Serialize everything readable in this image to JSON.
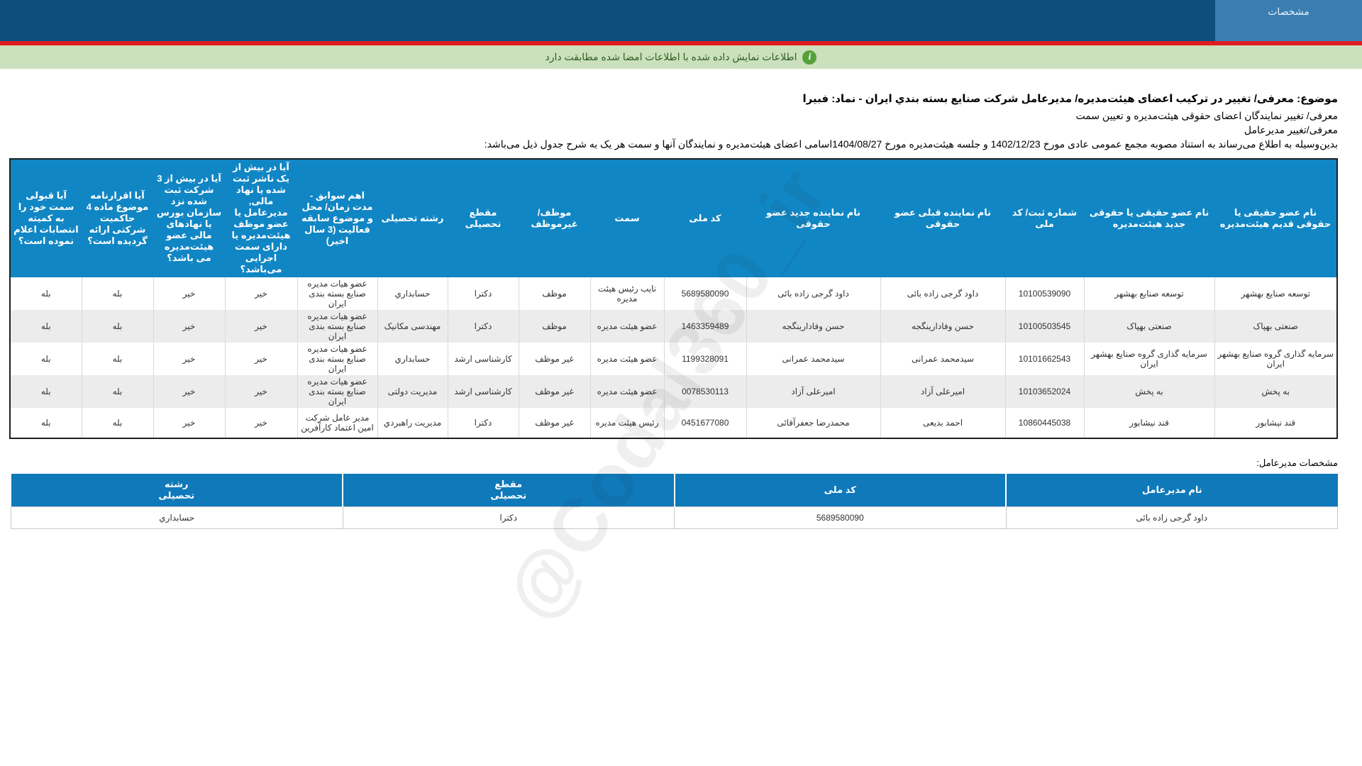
{
  "header": {
    "tab_label": "مشخصات"
  },
  "alert": {
    "text": "اطلاعات نمایش داده شده با اطلاعات امضا شده مطابقت دارد"
  },
  "intro": {
    "subject": "موضوع: معرفی/ تغییر در ترکیب اعضای هیئت‌مدیره/ مدیرعامل شرکت صنایع بسته بندي ایران - نماد: فبیرا",
    "line2": "معرفی/ تغییر نمایندگان اعضای حقوقی هیئت‌مدیره و تعیین سمت",
    "line3": "معرفی/تغییر مدیرعامل",
    "line4": "بدین‌وسیله به اطلاع می‌رساند به استناد مصوبه مجمع عمومی عادی مورخ  1402/12/23  و جلسه هیئت‌مدیره مورخ  1404/08/27اسامی اعضای هیئت‌مدیره و نمایندگان آنها و سمت هر یک به شرح جدول ذیل می‌باشد:"
  },
  "board_table": {
    "headers": [
      "نام عضو حقیقی یا حقوقی قدیم هیئت‌مدیره",
      "نام عضو حقیقی یا حقوقی جدید هیئت‌مدیره",
      "شماره ثبت/ کد ملی",
      "نام نماینده قبلی عضو حقوقی",
      "نام نماینده جدید عضو حقوقی",
      "کد ملی",
      "سمت",
      "موظف/ غیرموظف",
      "مقطع تحصیلی",
      "رشته تحصیلی",
      "اهم سوابق - مدت زمان/ محل و موضوع سابقه فعالیت (3 سال اخیر)",
      "آیا در بیش از یک ناشر ثبت شده یا نهاد مالی, مدیرعامل یا عضو موظف هیئت‌مدیره یا دارای سمت اجرایی می‌باشد؟",
      "آیا در بیش از 3 شرکت ثبت شده نزد سازمان بورس یا نهادهای مالی عضو هیئت‌مدیره می باشد؟",
      "آیا اقرارنامه موضوع ماده 4 حاکمیت شرکتی ارائه گردیده است؟",
      "آیا قبولی سمت خود را به کمیته انتصابات اعلام نموده است؟"
    ],
    "rows": [
      [
        "توسعه صنایع بهشهر",
        "توسعه صنایع بهشهر",
        "10100539090",
        "داود گرجی زاده بائی",
        "داود گرجی زاده بائی",
        "5689580090",
        "نایب رئیس هیئت مدیره",
        "موظف",
        "دکترا",
        "حسابداري",
        "عضو هیات مدیره صنایع بسته بندی ایران",
        "خیر",
        "خیر",
        "بله",
        "بله"
      ],
      [
        "صنعتی بهپاک",
        "صنعتی بهپاک",
        "10100503545",
        "حسن وفادارینگجه",
        "حسن وفادارینگجه",
        "1463359489",
        "عضو هیئت مدیره",
        "موظف",
        "دکترا",
        "مهندسی مکانیک",
        "عضو هیات مدیره صنایع بسته بندی ایران",
        "خیر",
        "خیر",
        "بله",
        "بله"
      ],
      [
        "سرمایه گذاری گروه صنایع بهشهر ایران",
        "سرمایه گذاری گروه صنایع بهشهر ایران",
        "10101662543",
        "سیدمحمد عمرانی",
        "سیدمحمد عمرانی",
        "1199328091",
        "عضو هیئت مدیره",
        "غیر موظف",
        "کارشناسی ارشد",
        "حسابداري",
        "عضو هیات مدیره صنایع بسته بندی ایران",
        "خیر",
        "خیر",
        "بله",
        "بله"
      ],
      [
        "به پخش",
        "به پخش",
        "10103652024",
        "امیرعلی آزاد",
        "امیرعلی آزاد",
        "0078530113",
        "عضو هیئت مدیره",
        "غیر موظف",
        "کارشناسی ارشد",
        "مدیریت دولتی",
        "عضو هیات مدیره صنایع بسته بندی ایران",
        "خیر",
        "خیر",
        "بله",
        "بله"
      ],
      [
        "قند نیشابور",
        "قند نیشابور",
        "10860445038",
        "احمد بدیعی",
        "محمدرضا جعفرآقائی",
        "0451677080",
        "رئیس هیئت مدیره",
        "غیر موظف",
        "دکترا",
        "مدیریت راهبردي",
        "مدیر عامل شرکت امین اعتماد کارآفرین",
        "خیر",
        "خیر",
        "بله",
        "بله"
      ]
    ]
  },
  "ceo_section": {
    "label": "مشخصات مدیرعامل:",
    "headers": [
      "نام مدیرعامل",
      "کد ملی",
      "مقطع\nتحصیلی",
      "رشته\nتحصیلی"
    ],
    "row": [
      "داود گرجی زاده بائی",
      "5689580090",
      "دکترا",
      "حسابداري"
    ]
  },
  "watermark": "@Codal360_ir",
  "colors": {
    "topbar": "#0e4e7d",
    "tab": "#3a7db1",
    "red_line": "#e11b22",
    "alert_bg": "#cbe0bc",
    "alert_icon": "#55a23c",
    "table_header": "#1186c4",
    "ceo_header": "#0f79ba",
    "row_alt": "#ececec"
  }
}
